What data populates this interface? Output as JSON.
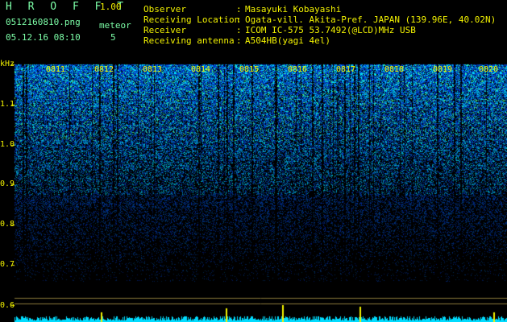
{
  "header": {
    "app_name": "H R O F F T",
    "app_version": "1.00",
    "file_name": "0512160810.png",
    "meteor_label": "meteor",
    "date_time": "05.12.16 08:10",
    "meteor_count": "5"
  },
  "info": [
    {
      "key": "Observer",
      "value": "Masayuki Kobayashi"
    },
    {
      "key": "Receiving Location",
      "value": "Ogata-vill. Akita-Pref. JAPAN (139.96E, 40.02N)"
    },
    {
      "key": "Receiver",
      "value": "ICOM IC-575 53.7492(@LCD)MHz USB"
    },
    {
      "key": "Receiving antenna",
      "value": "A504HB(yagi 4el)"
    }
  ],
  "spectrogram": {
    "y_unit": "kHz",
    "y_labels": [
      "1.1",
      "1.0",
      "0.9",
      "0.8",
      "0.7",
      "0.6"
    ],
    "time_labels": [
      "0811",
      "0812",
      "0813",
      "0814",
      "0815",
      "0816",
      "0817",
      "0818",
      "0819",
      "0820"
    ],
    "colors": {
      "text": "#f2f200",
      "signal": "#00e0ff",
      "background": "#000000"
    }
  }
}
